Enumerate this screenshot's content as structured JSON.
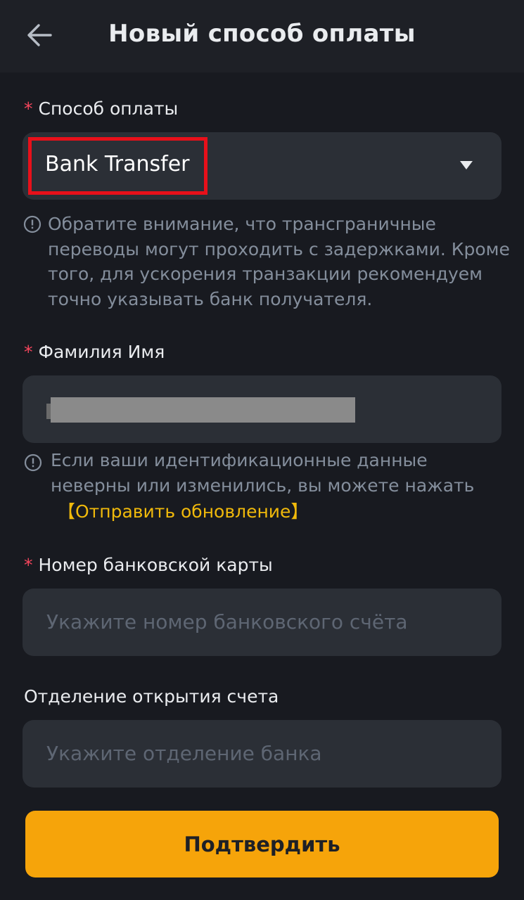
{
  "header": {
    "title": "Новый способ оплаты",
    "back_icon": "arrow-left-icon"
  },
  "payment_method": {
    "label": "Способ оплаты",
    "required_mark": "*",
    "value": "Bank Transfer",
    "hint": [
      "Обратите внимание, что трансграничные",
      "переводы могут проходить с задержками. Кроме",
      "того, для ускорения транзакции рекомендуем",
      "точно указывать банк получателя."
    ]
  },
  "full_name": {
    "label": "Фамилия Имя",
    "required_mark": "*",
    "hint": [
      "Если ваши идентификационные данные",
      "неверны или изменились, вы можете нажать"
    ],
    "link": "【Отправить обновление】"
  },
  "card_number": {
    "label": "Номер банковской карты",
    "required_mark": "*",
    "placeholder": "Укажите номер банковского счёта"
  },
  "branch": {
    "label": "Отделение открытия счета",
    "placeholder": "Укажите отделение банка"
  },
  "confirm_button": "Подтвердить",
  "colors": {
    "background": "#181A20",
    "field": "#2B2F36",
    "accent": "#F6A40A",
    "link": "#F0B90B",
    "required": "#F6465D",
    "highlight_box": "#E8101A"
  }
}
